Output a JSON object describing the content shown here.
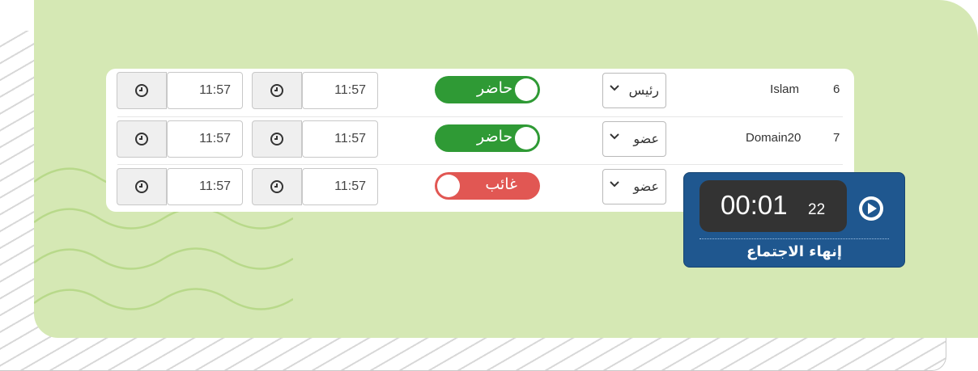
{
  "rows": [
    {
      "num": "6",
      "name": "Islam",
      "role": "رئيس",
      "status": "حاضر",
      "present": true,
      "time_in": "11:57",
      "time_out": "11:57"
    },
    {
      "num": "7",
      "name": "Domain20",
      "role": "عضو",
      "status": "حاضر",
      "present": true,
      "time_in": "11:57",
      "time_out": "11:57"
    },
    {
      "num": "",
      "name": "",
      "role": "عضو",
      "status": "غائب",
      "present": false,
      "time_in": "11:57",
      "time_out": "11:57"
    }
  ],
  "timer": {
    "display": "00:01",
    "seconds": "22",
    "end_label": "إنهاء الاجتماع"
  },
  "colors": {
    "panel": "#d5e8b4",
    "present": "#2f9a35",
    "absent": "#e15753",
    "timer_bg": "#1f578f"
  },
  "icons": {
    "clock": "clock-icon",
    "chevron": "chevron-down-icon",
    "play": "play-circle-icon"
  }
}
